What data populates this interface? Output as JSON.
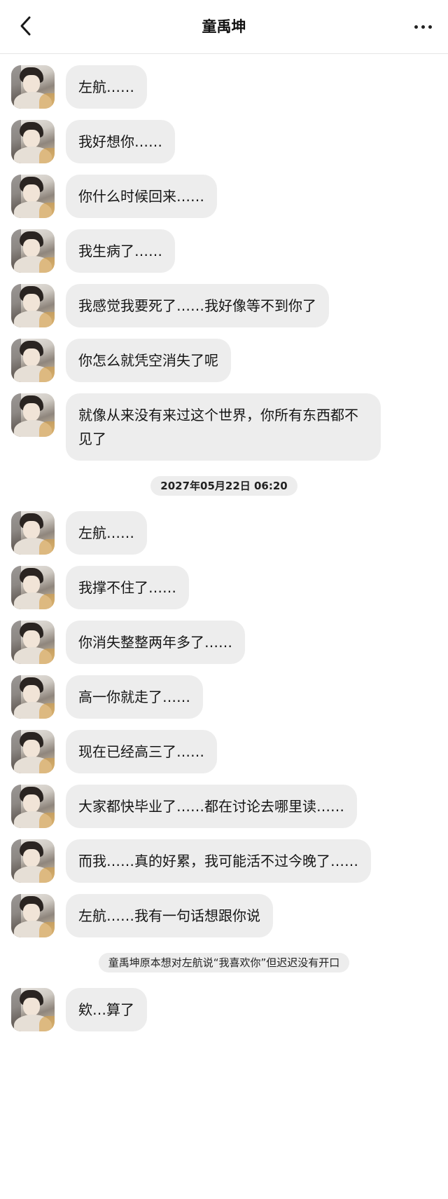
{
  "header": {
    "title": "童禹坤",
    "back_icon": "chevron-left-icon",
    "more_icon": "more-horizontal-icon"
  },
  "contact": {
    "avatar_icon": "contact-avatar"
  },
  "messages_part1": [
    "左航……",
    "我好想你……",
    "你什么时候回来……",
    "我生病了……",
    "我感觉我要死了……我好像等不到你了",
    "你怎么就凭空消失了呢",
    "就像从来没有来过这个世界，你所有东西都不见了"
  ],
  "timestamp": "2027年05月22日 06:20",
  "messages_part2": [
    "左航……",
    "我撑不住了……",
    "你消失整整两年多了……",
    "高一你就走了……",
    "现在已经高三了……",
    "大家都快毕业了……都在讨论去哪里读……",
    "而我……真的好累，我可能活不过今晚了……",
    "左航……我有一句话想跟你说"
  ],
  "notice": "童禹坤原本想对左航说“我喜欢你”但迟迟没有开口",
  "messages_part3": [
    "欸…算了"
  ],
  "colors": {
    "bubble_bg": "#ededed",
    "page_bg": "#ffffff",
    "text": "#151515"
  }
}
